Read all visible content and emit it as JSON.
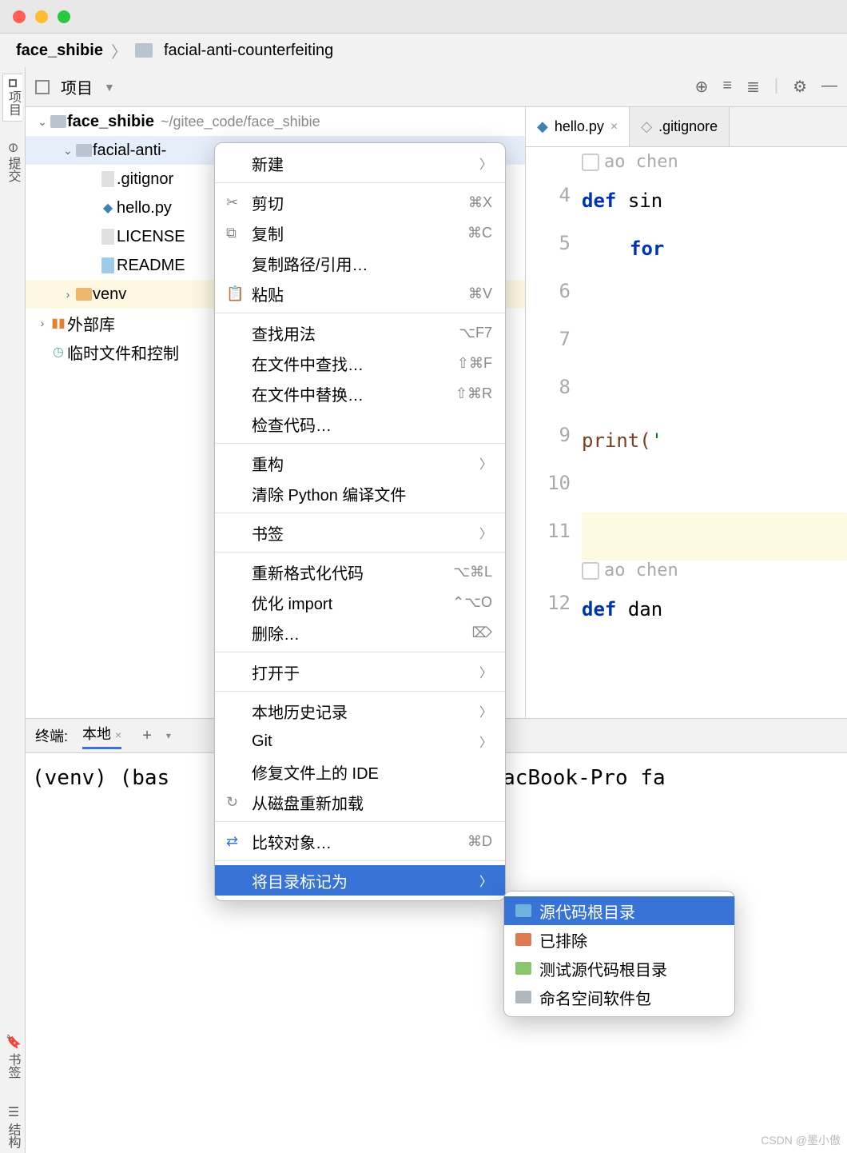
{
  "titlebar": {},
  "breadcrumb": {
    "root": "face_shibie",
    "child": "facial-anti-counterfeiting"
  },
  "sidebar": {
    "top": "项目",
    "commit": "提交",
    "bookmarks": "书签",
    "structure": "结构"
  },
  "panel": {
    "label": "项目"
  },
  "tree": {
    "root": "face_shibie",
    "root_path": "~/gitee_code/face_shibie",
    "items": [
      {
        "name": "facial-anti-"
      },
      {
        "name": ".gitignor"
      },
      {
        "name": "hello.py"
      },
      {
        "name": "LICENSE"
      },
      {
        "name": "README"
      },
      {
        "name": "venv"
      }
    ],
    "external": "外部库",
    "scratch": "临时文件和控制"
  },
  "tabs": {
    "t1": "hello.py",
    "t2": ".gitignore"
  },
  "editor": {
    "author1": "ao chen",
    "author2": "ao chen",
    "lines": {
      "4": "4",
      "5": "5",
      "6": "6",
      "7": "7",
      "8": "8",
      "9": "9",
      "10": "10",
      "11": "11",
      "12": "12"
    },
    "code": {
      "def1": "def",
      "sin": "sin",
      "for": "for",
      "print": "print(",
      "quote": "'",
      "def2": "def",
      "dan": "dan"
    }
  },
  "terminal": {
    "title": "终端:",
    "tab": "本地",
    "text": "(venv) (bas",
    "text2": "deMacBook-Pro fa"
  },
  "context_menu": {
    "new": "新建",
    "cut": "剪切",
    "cut_sc": "⌘X",
    "copy": "复制",
    "copy_sc": "⌘C",
    "copy_path": "复制路径/引用…",
    "paste": "粘贴",
    "paste_sc": "⌘V",
    "find_usages": "查找用法",
    "find_usages_sc": "⌥F7",
    "find_in_files": "在文件中查找…",
    "find_in_files_sc": "⇧⌘F",
    "replace_in_files": "在文件中替换…",
    "replace_in_files_sc": "⇧⌘R",
    "inspect": "检查代码…",
    "refactor": "重构",
    "clean_pyc": "清除 Python 编译文件",
    "bookmark": "书签",
    "reformat": "重新格式化代码",
    "reformat_sc": "⌥⌘L",
    "optimize": "优化 import",
    "optimize_sc": "⌃⌥O",
    "delete": "删除…",
    "delete_sc": "⌦",
    "open_in": "打开于",
    "local_history": "本地历史记录",
    "git": "Git",
    "repair_ide": "修复文件上的 IDE",
    "reload": "从磁盘重新加载",
    "compare": "比较对象…",
    "compare_sc": "⌘D",
    "mark_dir": "将目录标记为"
  },
  "submenu": {
    "src_root": "源代码根目录",
    "excluded": "已排除",
    "test_root": "测试源代码根目录",
    "namespace": "命名空间软件包"
  },
  "watermark": "CSDN @墨小傲"
}
